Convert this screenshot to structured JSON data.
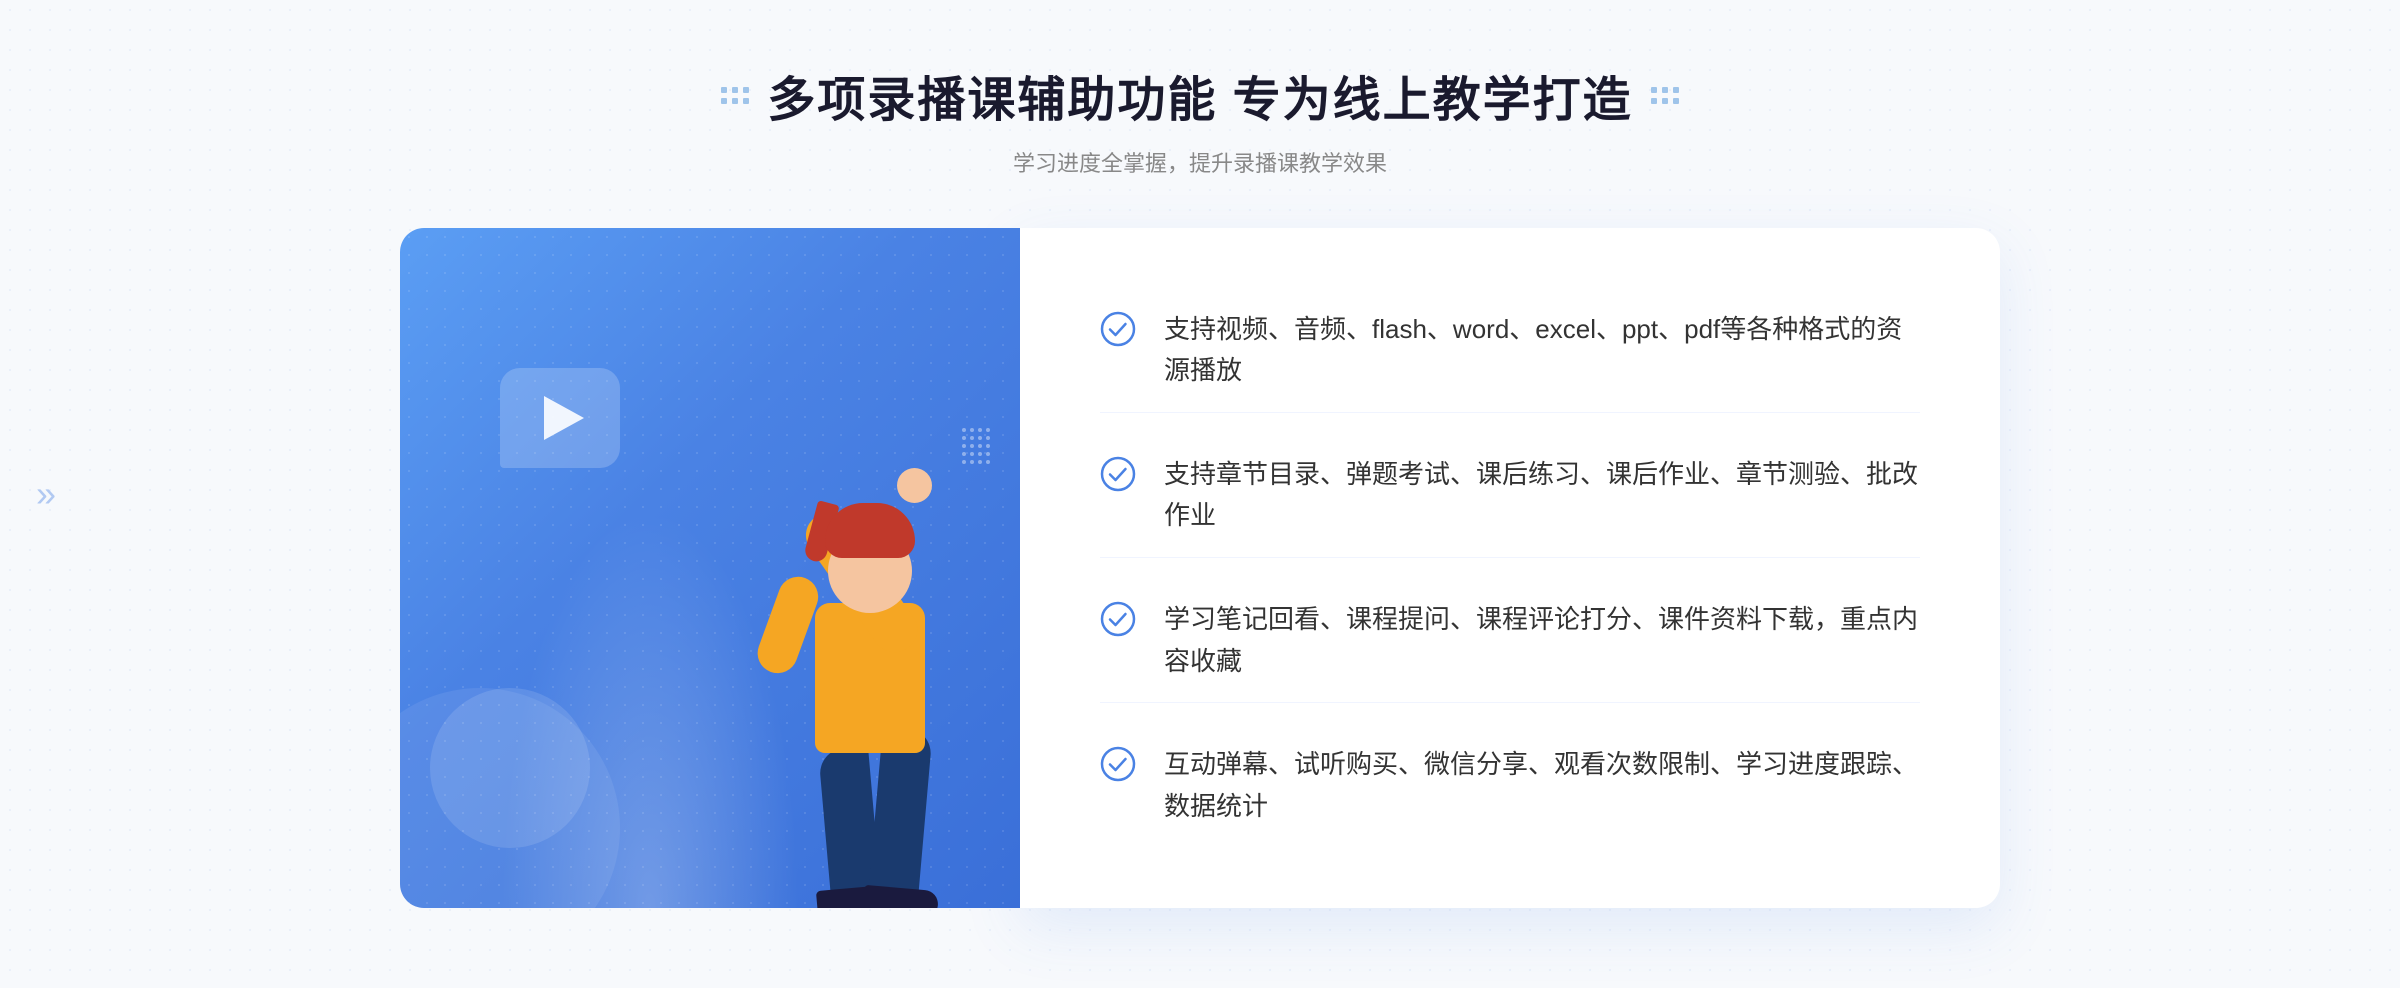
{
  "header": {
    "title": "多项录播课辅助功能 专为线上教学打造",
    "subtitle": "学习进度全掌握，提升录播课教学效果"
  },
  "features": [
    {
      "id": "feature-1",
      "text": "支持视频、音频、flash、word、excel、ppt、pdf等各种格式的资源播放"
    },
    {
      "id": "feature-2",
      "text": "支持章节目录、弹题考试、课后练习、课后作业、章节测验、批改作业"
    },
    {
      "id": "feature-3",
      "text": "学习笔记回看、课程提问、课程评论打分、课件资料下载，重点内容收藏"
    },
    {
      "id": "feature-4",
      "text": "互动弹幕、试听购买、微信分享、观看次数限制、学习进度跟踪、数据统计"
    }
  ],
  "check_icon_color": "#4a82e4",
  "decoration": {
    "left_arrow": "»"
  }
}
